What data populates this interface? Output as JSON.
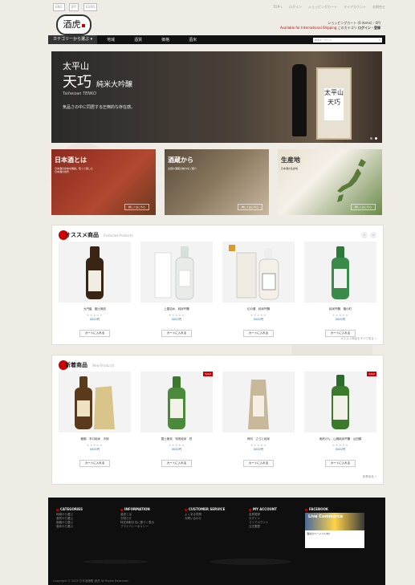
{
  "topbar": {
    "lang": "ENG",
    "currency": "JPY",
    "currency2": "EURO",
    "links": [
      "TOPへ",
      "ログイン",
      "ショッピングカート",
      "マイアカウント",
      "お問合せ"
    ]
  },
  "header": {
    "logo": "酒虎",
    "cart_text": "ショッピングカート (0 items) : 0円",
    "shipping": "Available for International Shipping",
    "account_link": "このカテゴリ",
    "account_cta": "ログイン・登録"
  },
  "nav": {
    "category": "カテゴリーから選ぶ",
    "items": [
      "地域",
      "酒質",
      "価格",
      "酒米"
    ],
    "search_placeholder": "検索キーワード"
  },
  "hero": {
    "brewery": "太平山",
    "product": "天巧",
    "type": "純米大吟醸",
    "romaji": "Taiheizan TENKO",
    "tagline": "気品さの中に同居する圧倒的な存在感。",
    "box_label": "太平山 天巧"
  },
  "banners": [
    {
      "title": "日本酒とは",
      "sub": "日本酒の基本を解説。知って楽しむ日本酒の世界",
      "more": "詳しくはこちら"
    },
    {
      "title": "酒蔵から",
      "sub": "全国の酒蔵の魅力をご紹介",
      "more": "詳しくはこちら"
    },
    {
      "title": "生産地",
      "sub": "日本酒の生産地",
      "more": "詳しくはこちら"
    }
  ],
  "recommended": {
    "title": "オススメ商品",
    "title_en": "Featured Products",
    "see_more": "オススメ商品をすべて見る »",
    "products": [
      {
        "name": "大円盤　國士無双",
        "price": "0000円",
        "cart": "カートに入れる",
        "label": "國士無双",
        "bottle_color": "#3a2414"
      },
      {
        "name": "上善如水　純米吟醸",
        "price": "0000円",
        "cart": "カートに入れる",
        "label": "上善",
        "bottle_color": "#e8ece8"
      },
      {
        "name": "幻の瀧　純米吟醸",
        "price": "0000円",
        "cart": "カートに入れる",
        "label": "幻の瀧",
        "bottle_color": "#f0ebe2"
      },
      {
        "name": "純米吟醸　福小町",
        "price": "0000円",
        "cart": "カートに入れる",
        "label": "福小町",
        "bottle_color": "#3a8a4a"
      }
    ]
  },
  "new_items": {
    "title": "新着商品",
    "title_en": "New Products",
    "see_more": "新着商品 »",
    "products": [
      {
        "name": "都錦　辛口純米　冷卸",
        "price": "0000円",
        "cart": "カートに入れる",
        "label": "冷卸",
        "bottle_color": "#5a3a1a",
        "sale": ""
      },
      {
        "name": "国士無双　特別純米　烈",
        "price": "0000円",
        "cart": "カートに入れる",
        "label": "國士無双",
        "bottle_color": "#4a8a3a",
        "sale": "SALE"
      },
      {
        "name": "神月　さらと純米",
        "price": "0000円",
        "cart": "カートに入れる",
        "label": "神月",
        "bottle_color": "#c8b89a",
        "sale": ""
      },
      {
        "name": "奥尻げん　山廃純米吟醸　山田錦",
        "price": "0000円",
        "cart": "カートに入れる",
        "label": "山廃",
        "bottle_color": "#3a7a2a",
        "sale": "SALE"
      }
    ]
  },
  "footer": {
    "columns": [
      {
        "title": "CATEGORIES",
        "items": [
          "地域から選ぶ",
          "酒質から選ぶ",
          "価格から選ぶ",
          "酒米から選ぶ"
        ]
      },
      {
        "title": "INFORMATION",
        "items": [
          "酒虎とは",
          "お知らせ",
          "特定商取引法に基づく表示",
          "プライバシーポリシー"
        ]
      },
      {
        "title": "CUSTOMER SERVICE",
        "items": [
          "よくある質問",
          "お問い合わせ"
        ]
      },
      {
        "title": "MY ACCOUNT",
        "items": [
          "会員登録",
          "ログイン",
          "マイアカウント",
          "注文履歴"
        ]
      }
    ],
    "facebook_title": "FACEBOOK",
    "fb_name": "Live Commerce",
    "fb_text": "酒虎のページ",
    "fb_like": "いいね！",
    "copyright": "Copyright © 2015 日本酒通販 酒虎 All Rights Reserved."
  }
}
